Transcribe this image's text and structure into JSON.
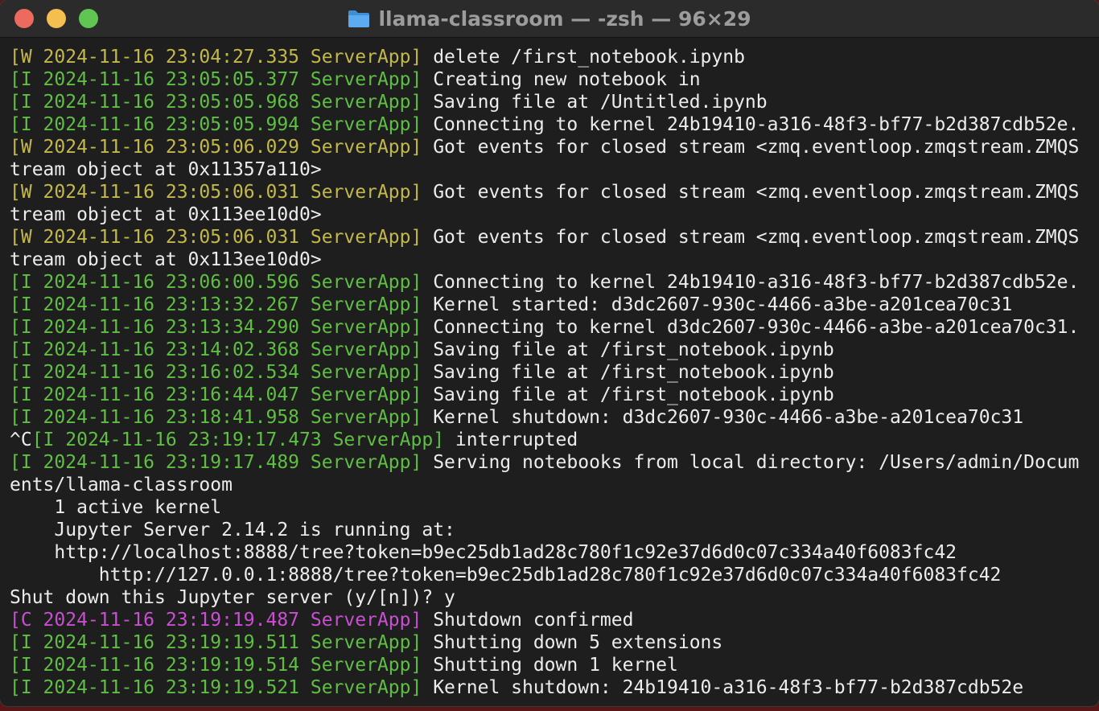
{
  "window": {
    "title": "llama-classroom — -zsh — 96×29",
    "icon": "folder-icon"
  },
  "terminal": {
    "lines": [
      {
        "type": "log",
        "level": "W",
        "prefix": "[W 2024-11-16 23:04:27.335 ServerApp]",
        "message": " delete /first_notebook.ipynb"
      },
      {
        "type": "log",
        "level": "I",
        "prefix": "[I 2024-11-16 23:05:05.377 ServerApp]",
        "message": " Creating new notebook in"
      },
      {
        "type": "log",
        "level": "I",
        "prefix": "[I 2024-11-16 23:05:05.968 ServerApp]",
        "message": " Saving file at /Untitled.ipynb"
      },
      {
        "type": "log",
        "level": "I",
        "prefix": "[I 2024-11-16 23:05:05.994 ServerApp]",
        "message": " Connecting to kernel 24b19410-a316-48f3-bf77-b2d387cdb52e."
      },
      {
        "type": "log",
        "level": "W",
        "prefix": "[W 2024-11-16 23:05:06.029 ServerApp]",
        "message": " Got events for closed stream <zmq.eventloop.zmqstream.ZMQS"
      },
      {
        "type": "text",
        "text": "tream object at 0x11357a110>"
      },
      {
        "type": "log",
        "level": "W",
        "prefix": "[W 2024-11-16 23:05:06.031 ServerApp]",
        "message": " Got events for closed stream <zmq.eventloop.zmqstream.ZMQS"
      },
      {
        "type": "text",
        "text": "tream object at 0x113ee10d0>"
      },
      {
        "type": "log",
        "level": "W",
        "prefix": "[W 2024-11-16 23:05:06.031 ServerApp]",
        "message": " Got events for closed stream <zmq.eventloop.zmqstream.ZMQS"
      },
      {
        "type": "text",
        "text": "tream object at 0x113ee10d0>"
      },
      {
        "type": "log",
        "level": "I",
        "prefix": "[I 2024-11-16 23:06:00.596 ServerApp]",
        "message": " Connecting to kernel 24b19410-a316-48f3-bf77-b2d387cdb52e."
      },
      {
        "type": "log",
        "level": "I",
        "prefix": "[I 2024-11-16 23:13:32.267 ServerApp]",
        "message": " Kernel started: d3dc2607-930c-4466-a3be-a201cea70c31"
      },
      {
        "type": "log",
        "level": "I",
        "prefix": "[I 2024-11-16 23:13:34.290 ServerApp]",
        "message": " Connecting to kernel d3dc2607-930c-4466-a3be-a201cea70c31."
      },
      {
        "type": "log",
        "level": "I",
        "prefix": "[I 2024-11-16 23:14:02.368 ServerApp]",
        "message": " Saving file at /first_notebook.ipynb"
      },
      {
        "type": "log",
        "level": "I",
        "prefix": "[I 2024-11-16 23:16:02.534 ServerApp]",
        "message": " Saving file at /first_notebook.ipynb"
      },
      {
        "type": "log",
        "level": "I",
        "prefix": "[I 2024-11-16 23:16:44.047 ServerApp]",
        "message": " Saving file at /first_notebook.ipynb"
      },
      {
        "type": "log",
        "level": "I",
        "prefix": "[I 2024-11-16 23:18:41.958 ServerApp]",
        "message": " Kernel shutdown: d3dc2607-930c-4466-a3be-a201cea70c31"
      },
      {
        "type": "log",
        "level": "I",
        "lead": "^C",
        "prefix": "[I 2024-11-16 23:19:17.473 ServerApp]",
        "message": " interrupted"
      },
      {
        "type": "log",
        "level": "I",
        "prefix": "[I 2024-11-16 23:19:17.489 ServerApp]",
        "message": " Serving notebooks from local directory: /Users/admin/Docum"
      },
      {
        "type": "text",
        "text": "ents/llama-classroom"
      },
      {
        "type": "text",
        "text": "    1 active kernel"
      },
      {
        "type": "text",
        "text": "    Jupyter Server 2.14.2 is running at:"
      },
      {
        "type": "text",
        "text": "    http://localhost:8888/tree?token=b9ec25db1ad28c780f1c92e37d6d0c07c334a40f6083fc42"
      },
      {
        "type": "text",
        "text": "        http://127.0.0.1:8888/tree?token=b9ec25db1ad28c780f1c92e37d6d0c07c334a40f6083fc42"
      },
      {
        "type": "text",
        "text": "Shut down this Jupyter server (y/[n])? y"
      },
      {
        "type": "log",
        "level": "C",
        "prefix": "[C 2024-11-16 23:19:19.487 ServerApp]",
        "message": " Shutdown confirmed"
      },
      {
        "type": "log",
        "level": "I",
        "prefix": "[I 2024-11-16 23:19:19.511 ServerApp]",
        "message": " Shutting down 5 extensions"
      },
      {
        "type": "log",
        "level": "I",
        "prefix": "[I 2024-11-16 23:19:19.514 ServerApp]",
        "message": " Shutting down 1 kernel"
      },
      {
        "type": "log",
        "level": "I",
        "prefix": "[I 2024-11-16 23:19:19.521 ServerApp]",
        "message": " Kernel shutdown: 24b19410-a316-48f3-bf77-b2d387cdb52e"
      }
    ]
  }
}
